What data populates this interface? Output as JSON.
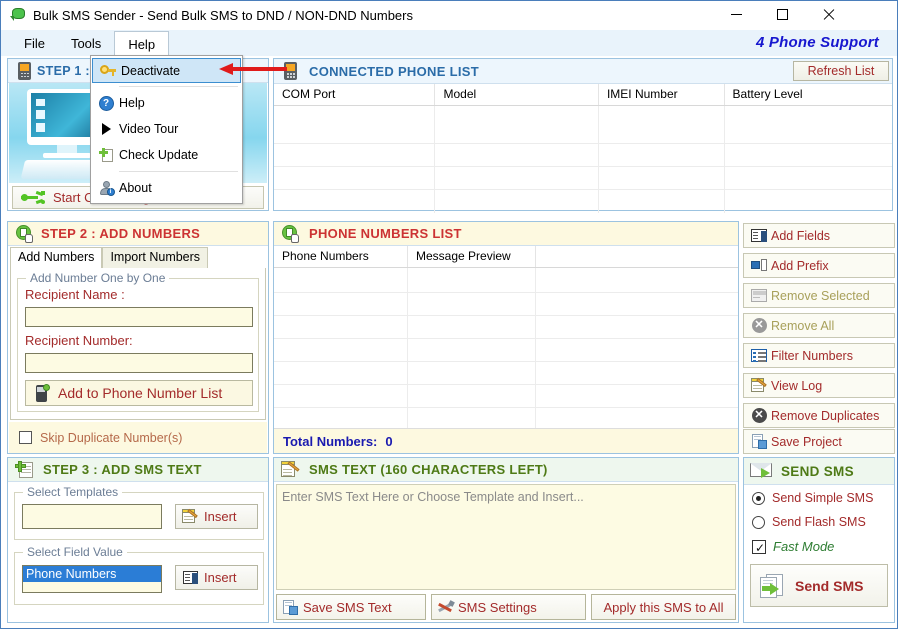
{
  "window": {
    "title": "Bulk SMS Sender - Send Bulk SMS to DND / NON-DND Numbers",
    "minimize": "–",
    "maximize": "□",
    "close": "✕",
    "brand": "4 Phone Support"
  },
  "menubar": {
    "items": [
      {
        "label": "File"
      },
      {
        "label": "Tools"
      },
      {
        "label": "Help"
      }
    ]
  },
  "help_menu": {
    "items": [
      {
        "label": "Deactivate",
        "icon": "key-icon",
        "selected": true
      },
      {
        "label": "Help",
        "icon": "question-circle-icon",
        "selected": false
      },
      {
        "label": "Video Tour",
        "icon": "play-triangle-icon",
        "selected": false
      },
      {
        "label": "Check Update",
        "icon": "page-plus-icon",
        "selected": false
      },
      {
        "label": "About",
        "icon": "about-person-icon",
        "selected": false
      }
    ]
  },
  "step1": {
    "title": "STEP 1 :",
    "icon": "phone-icon",
    "connect_button": "Start Connecting Phones",
    "connect_icon": "usb-icon"
  },
  "connected_phones": {
    "title": "CONNECTED PHONE LIST",
    "icon": "phone-icon",
    "refresh_label": "Refresh List",
    "columns": [
      "COM  Port",
      "Model",
      "IMEI Number",
      "Battery Level"
    ],
    "rows": []
  },
  "step2": {
    "title": "STEP 2 : ADD NUMBERS",
    "icon": "green-sim-icon",
    "tabs": [
      {
        "label": "Add Numbers",
        "active": true
      },
      {
        "label": "Import Numbers",
        "active": false
      }
    ],
    "group_caption": "Add Number One by One",
    "recipient_name_label": "Recipient Name :",
    "recipient_name_value": "",
    "recipient_number_label": "Recipient Number:",
    "recipient_number_value": "",
    "add_button": "Add to Phone Number List",
    "add_button_icon": "phone-plus-icon",
    "skip_duplicate_label": "Skip Duplicate Number(s)",
    "skip_duplicate_checked": false
  },
  "phone_numbers_list": {
    "title": "PHONE NUMBERS LIST",
    "icon": "green-sim-icon",
    "columns": [
      "Phone Numbers",
      "Message Preview",
      ""
    ],
    "rows": [],
    "total_label": "Total Numbers:",
    "total_value": "0"
  },
  "actions": {
    "buttons": [
      {
        "label": "Add Fields",
        "icon": "add-fields-icon",
        "dim": false
      },
      {
        "label": "Add Prefix",
        "icon": "add-prefix-icon",
        "dim": false
      },
      {
        "label": "Remove Selected",
        "icon": "remove-selected-icon",
        "dim": true
      },
      {
        "label": "Remove All",
        "icon": "remove-all-icon",
        "dim": true
      },
      {
        "label": "Filter Numbers",
        "icon": "filter-icon",
        "dim": false
      },
      {
        "label": "View Log",
        "icon": "view-log-icon",
        "dim": false
      },
      {
        "label": "Remove Duplicates",
        "icon": "remove-duplicates-icon",
        "dim": false
      },
      {
        "label": "Save Project",
        "icon": "save-project-icon",
        "dim": false
      }
    ]
  },
  "step3": {
    "title": "STEP 3 : ADD SMS TEXT",
    "icon": "doc-plus-icon",
    "templates_caption": "Select Templates",
    "templates_value": "",
    "templates_insert": "Insert",
    "templates_insert_icon": "notepad-pencil-icon",
    "field_value_caption": "Select Field Value",
    "field_value_selected": "Phone Numbers",
    "field_insert": "Insert",
    "field_insert_icon": "insert-field-icon"
  },
  "sms_text": {
    "title": "SMS TEXT (160 CHARACTERS LEFT)",
    "icon": "notepad-pencil-icon",
    "placeholder": "Enter SMS Text Here or Choose Template and Insert...",
    "value": "",
    "buttons": [
      {
        "label": "Save SMS Text",
        "icon": "save-icon"
      },
      {
        "label": "SMS Settings",
        "icon": "tools-icon"
      },
      {
        "label": "Apply this SMS to All",
        "icon": "none"
      }
    ]
  },
  "send_sms": {
    "title": "SEND SMS",
    "icon": "envelope-icon",
    "options": [
      {
        "label": "Send Simple SMS",
        "selected": true
      },
      {
        "label": "Send Flash SMS",
        "selected": false
      }
    ],
    "fast_mode_label": "Fast Mode",
    "fast_mode_checked": true,
    "send_button": "Send SMS",
    "send_button_icon": "send-doc-icon"
  },
  "colors": {
    "window_border": "#4a7ebb",
    "brand": "#1717cf",
    "header_blue": "#2b6ca8",
    "header_red": "#cc3333",
    "header_green": "#4e7a16",
    "button_text": "#a32b2b",
    "arrow": "#e01b1b",
    "total_numbers": "#1a1ab0"
  }
}
